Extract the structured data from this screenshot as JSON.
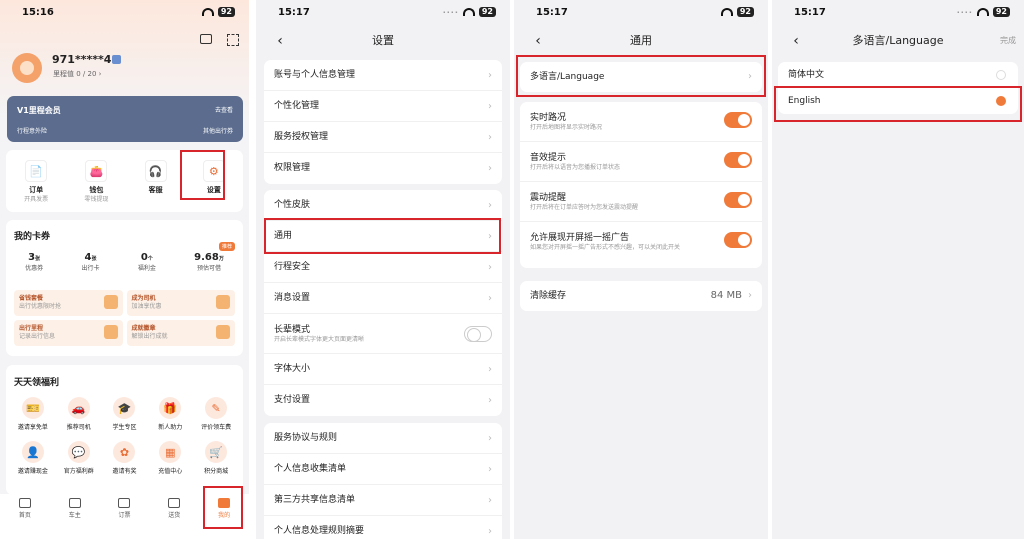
{
  "p1": {
    "time": "15:16",
    "batt": "92",
    "user": "971*****4",
    "mileage_label": "里程值",
    "mileage": "0 / 20",
    "vip_title": "V1里程会员",
    "vip_link": "去查看",
    "vip_sub1": "行程意外险",
    "vip_sub2": "其他出行券",
    "shortcuts": [
      {
        "label": "订单",
        "sub": "开具发票",
        "icon": "📄"
      },
      {
        "label": "钱包",
        "sub": "零钱提现",
        "icon": "👛"
      },
      {
        "label": "客服",
        "sub": "",
        "icon": "🎧"
      },
      {
        "label": "设置",
        "sub": "",
        "icon": "⚙"
      }
    ],
    "coupons_title": "我的卡券",
    "badge": "推荐",
    "stats": [
      {
        "v": "3",
        "u": "张",
        "l": "优惠券"
      },
      {
        "v": "4",
        "u": "张",
        "l": "出行卡"
      },
      {
        "v": "0",
        "u": "个",
        "l": "福利金"
      },
      {
        "v": "9.68",
        "u": "万",
        "l": "预估可借"
      }
    ],
    "promos": [
      {
        "t": "省钱套餐",
        "s": "出行优惠限时抢"
      },
      {
        "t": "成为司机",
        "s": "加油享优惠"
      },
      {
        "t": "出行里程",
        "s": "记录出行信息"
      },
      {
        "t": "成就徽章",
        "s": "解锁出行成就"
      }
    ],
    "welfare_title": "天天领福利",
    "welfare": [
      {
        "l": "邀请享免单",
        "i": "🎫"
      },
      {
        "l": "推荐司机",
        "i": "🚗"
      },
      {
        "l": "学生专区",
        "i": "🎓"
      },
      {
        "l": "新人助力",
        "i": "🎁"
      },
      {
        "l": "评价领车费",
        "i": "✎"
      },
      {
        "l": "邀请赚现金",
        "i": "👤"
      },
      {
        "l": "官方福利群",
        "i": "💬"
      },
      {
        "l": "邀请有奖",
        "i": "✿"
      },
      {
        "l": "充值中心",
        "i": "▦"
      },
      {
        "l": "积分商城",
        "i": "🛒"
      }
    ],
    "tabs": [
      "首页",
      "车主",
      "订票",
      "送货",
      "我的"
    ]
  },
  "p2": {
    "time": "15:17",
    "title": "设置",
    "g1": [
      "账号与个人信息管理",
      "个性化管理",
      "服务授权管理",
      "权限管理"
    ],
    "g2": [
      "个性皮肤",
      "通用",
      "行程安全",
      "消息设置"
    ],
    "elder": "长辈模式",
    "elder_sub": "开启长辈模式字体更大页面更清晰",
    "g2b": [
      "字体大小",
      "支付设置"
    ],
    "g3": [
      "服务协议与规则",
      "个人信息收集清单",
      "第三方共享信息清单",
      "个人信息处理规则摘要"
    ]
  },
  "p3": {
    "time": "15:17",
    "title": "通用",
    "lang": "多语言/Language",
    "toggles": [
      {
        "t": "实时路况",
        "s": "打开后地图将显示实时路况"
      },
      {
        "t": "音效提示",
        "s": "打开后将以语音为您播报订单状态"
      },
      {
        "t": "震动提醒",
        "s": "打开后将在订单应答时为您发送震动提醒"
      },
      {
        "t": "允许展现开屏摇一摇广告",
        "s": "如果您对开屏摇一摇广告形式不感兴趣，可以关闭此开关"
      }
    ],
    "cache": "清除缓存",
    "cache_size": "84 MB"
  },
  "p4": {
    "time": "15:17",
    "title": "多语言/Language",
    "done": "完成",
    "opt1": "简体中文",
    "opt2": "English"
  }
}
